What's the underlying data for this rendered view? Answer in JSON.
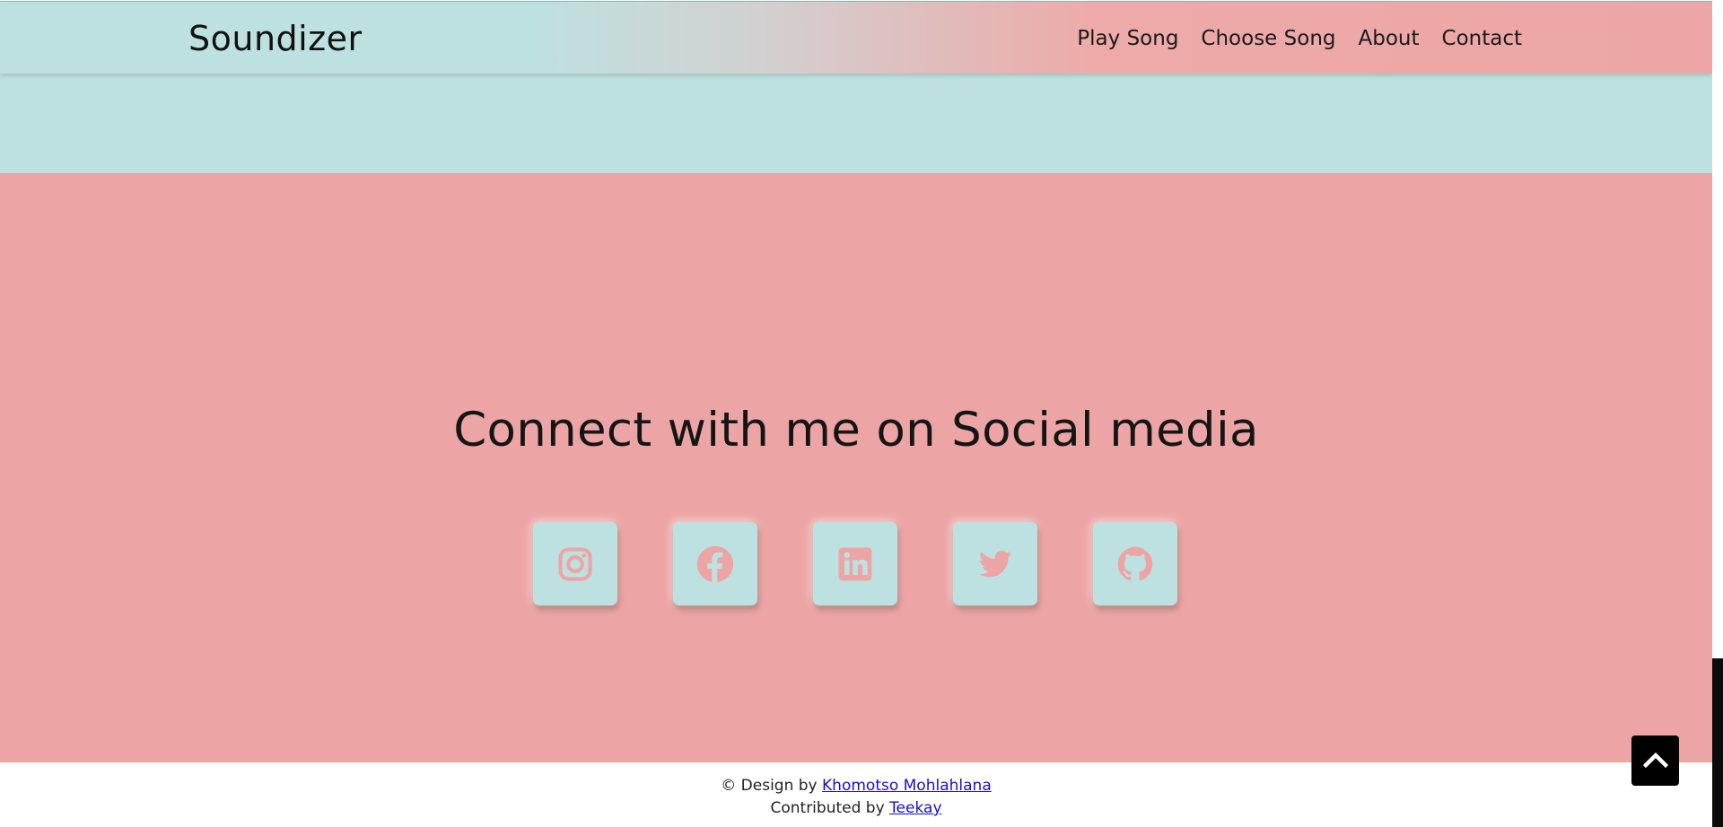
{
  "header": {
    "brand": "Soundizer",
    "nav": [
      "Play Song",
      "Choose Song",
      "About",
      "Contact"
    ]
  },
  "social": {
    "heading": "Connect with me on Social media",
    "buttons": [
      {
        "icon": "instagram-icon"
      },
      {
        "icon": "facebook-icon"
      },
      {
        "icon": "linkedin-icon"
      },
      {
        "icon": "twitter-icon"
      },
      {
        "icon": "github-icon"
      }
    ]
  },
  "footer": {
    "line1_prefix": "© Design by",
    "designer": "Khomotso Mohlahlana",
    "line2_prefix": "Contributed by",
    "contributor": "Teekay"
  },
  "colors": {
    "teal": "#bde1e0",
    "pink": "#eca5a4",
    "link": "#1a0dcc"
  }
}
